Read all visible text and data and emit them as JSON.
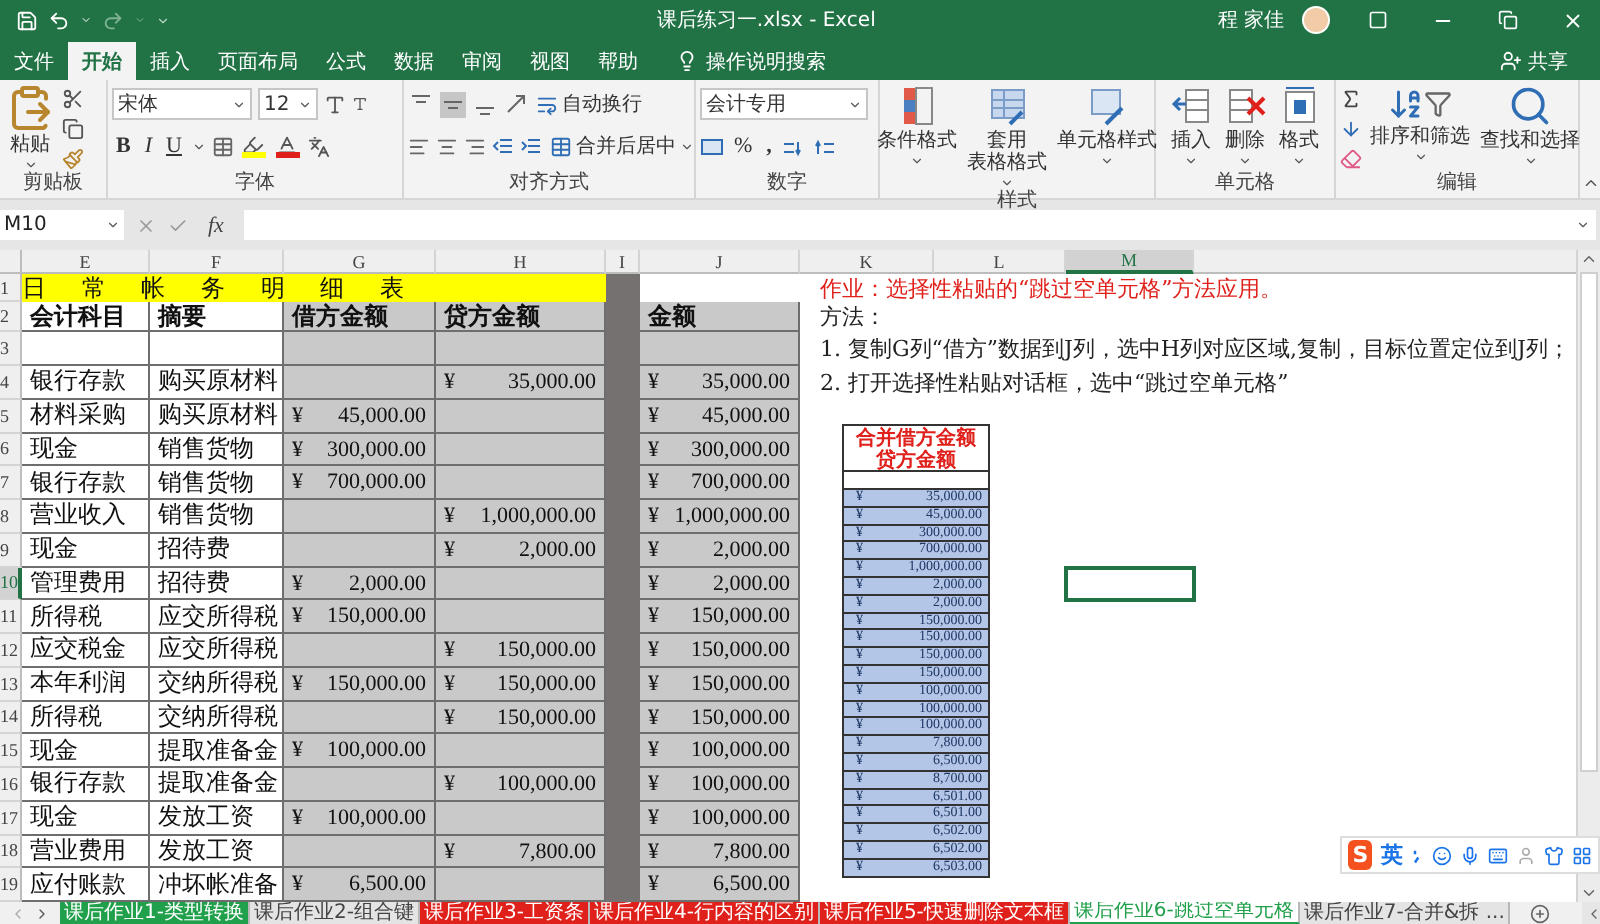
{
  "window": {
    "title": "课后练习一.xlsx - Excel",
    "user": "程 家佳"
  },
  "menu_tabs": [
    {
      "label": "文件",
      "selected": false
    },
    {
      "label": "开始",
      "selected": true
    },
    {
      "label": "插入",
      "selected": false
    },
    {
      "label": "页面布局",
      "selected": false
    },
    {
      "label": "公式",
      "selected": false
    },
    {
      "label": "数据",
      "selected": false
    },
    {
      "label": "审阅",
      "selected": false
    },
    {
      "label": "视图",
      "selected": false
    },
    {
      "label": "帮助",
      "selected": false
    }
  ],
  "tell_me": "操作说明搜索",
  "share": "共享",
  "ribbon": {
    "clipboard": {
      "label": "剪贴板",
      "paste": "粘贴"
    },
    "font": {
      "label": "字体",
      "name": "宋体",
      "size": "12",
      "styles": [
        "B",
        "I",
        "U"
      ]
    },
    "alignment": {
      "label": "对齐方式",
      "wrap": "自动换行",
      "merge": "合并后居中",
      "vertical_align": [
        {
          "selected": false
        },
        {
          "selected": true
        },
        {
          "selected": false
        }
      ]
    },
    "number": {
      "label": "数字",
      "format": "会计专用",
      "percent": "%",
      "comma": ","
    },
    "styles": {
      "label": "样式",
      "items": [
        {
          "lines": [
            "条件格式"
          ]
        },
        {
          "lines": [
            "套用",
            "表格格式"
          ]
        },
        {
          "lines": [
            "单元格样式"
          ]
        }
      ]
    },
    "cells": {
      "label": "单元格",
      "items": [
        "插入",
        "删除",
        "格式"
      ]
    },
    "editing": {
      "label": "编辑",
      "items": [
        "排序和筛选",
        "查找和选择"
      ]
    }
  },
  "formula_bar": {
    "name_box": "M10",
    "fx": "fx"
  },
  "sheet": {
    "columns": [
      {
        "label": "E",
        "selected": false
      },
      {
        "label": "F",
        "selected": false
      },
      {
        "label": "G",
        "selected": false
      },
      {
        "label": "H",
        "selected": false
      },
      {
        "label": "I",
        "selected": false
      },
      {
        "label": "J",
        "selected": false
      },
      {
        "label": "K",
        "selected": false
      },
      {
        "label": "L",
        "selected": false
      },
      {
        "label": "M",
        "selected": true
      }
    ],
    "row_numbers": [
      {
        "label": "1",
        "selected": false
      },
      {
        "label": "2",
        "selected": false
      },
      {
        "label": "3",
        "selected": false
      },
      {
        "label": "4",
        "selected": false
      },
      {
        "label": "5",
        "selected": false
      },
      {
        "label": "6",
        "selected": false
      },
      {
        "label": "7",
        "selected": false
      },
      {
        "label": "8",
        "selected": false
      },
      {
        "label": "9",
        "selected": false
      },
      {
        "label": "10",
        "selected": true
      },
      {
        "label": "11",
        "selected": false
      },
      {
        "label": "12",
        "selected": false
      },
      {
        "label": "13",
        "selected": false
      },
      {
        "label": "14",
        "selected": false
      },
      {
        "label": "15",
        "selected": false
      },
      {
        "label": "16",
        "selected": false
      },
      {
        "label": "17",
        "selected": false
      },
      {
        "label": "18",
        "selected": false
      },
      {
        "label": "19",
        "selected": false
      }
    ],
    "title": "日 常 帐 务 明 细 表",
    "headers": {
      "account": "会计科目",
      "summary": "摘要",
      "debit": "借方金额",
      "credit": "贷方金额",
      "amount": "金额"
    },
    "entries": [
      {
        "account": "银行存款",
        "summary": "购买原材料",
        "credit": "¥ 35,000.00",
        "amount": "¥ 35,000.00"
      },
      {
        "account": "材料采购",
        "summary": "购买原材料",
        "debit": "¥ 45,000.00",
        "amount": "¥ 45,000.00"
      },
      {
        "account": "现金",
        "summary": "销售货物",
        "debit": "¥ 300,000.00",
        "amount": "¥ 300,000.00"
      },
      {
        "account": "银行存款",
        "summary": "销售货物",
        "debit": "¥ 700,000.00",
        "amount": "¥ 700,000.00"
      },
      {
        "account": "营业收入",
        "summary": "销售货物",
        "credit": "¥ 1,000,000.00",
        "amount": "¥ 1,000,000.00"
      },
      {
        "account": "现金",
        "summary": "招待费",
        "credit": "¥ 2,000.00",
        "amount": "¥ 2,000.00"
      },
      {
        "account": "管理费用",
        "summary": "招待费",
        "debit": "¥ 2,000.00",
        "amount": "¥ 2,000.00"
      },
      {
        "account": "所得税",
        "summary": "应交所得税",
        "debit": "¥ 150,000.00",
        "amount": "¥ 150,000.00"
      },
      {
        "account": "应交税金",
        "summary": "应交所得税",
        "credit": "¥ 150,000.00",
        "amount": "¥ 150,000.00"
      },
      {
        "account": "本年利润",
        "summary": "交纳所得税",
        "debit": "¥ 150,000.00",
        "credit": "¥ 150,000.00",
        "amount": "¥ 150,000.00"
      },
      {
        "account": "所得税",
        "summary": "交纳所得税",
        "credit": "¥ 150,000.00",
        "amount": "¥ 150,000.00"
      },
      {
        "account": "现金",
        "summary": "提取准备金",
        "debit": "¥ 100,000.00",
        "amount": "¥ 100,000.00"
      },
      {
        "account": "银行存款",
        "summary": "提取准备金",
        "credit": "¥ 100,000.00",
        "amount": "¥ 100,000.00"
      },
      {
        "account": "现金",
        "summary": "发放工资",
        "debit": "¥ 100,000.00",
        "amount": "¥ 100,000.00"
      },
      {
        "account": "营业费用",
        "summary": "发放工资",
        "credit": "¥ 7,800.00",
        "amount": "¥ 7,800.00"
      },
      {
        "account": "应付账款",
        "summary": "冲坏帐准备",
        "debit": "¥ 6,500.00",
        "amount": "¥ 6,500.00"
      }
    ],
    "notes": [
      {
        "kind": "task",
        "text": "作业：选择性粘贴的“跳过空单元格”方法应用。"
      },
      {
        "kind": "plain",
        "text": "方法："
      },
      {
        "kind": "plain",
        "text": "1. 复制G列“借方”数据到J列，选中H列对应区域,复制，目标位置定位到J列；"
      },
      {
        "kind": "plain",
        "text": "2. 打开选择性粘贴对话框，选中“跳过空单元格”"
      }
    ],
    "picture": {
      "heading_lines": [
        "合并借方金额",
        "贷方金额"
      ],
      "values": [
        "¥ 35,000.00",
        "¥ 45,000.00",
        "¥ 300,000.00",
        "¥ 700,000.00",
        "¥ 1,000,000.00",
        "¥ 2,000.00",
        "¥ 2,000.00",
        "¥ 150,000.00",
        "¥ 150,000.00",
        "¥ 150,000.00",
        "¥ 150,000.00",
        "¥ 100,000.00",
        "¥ 100,000.00",
        "¥ 100,000.00",
        "¥ 7,800.00",
        "¥ 6,500.00",
        "¥ 8,700.00",
        "¥ 6,501.00",
        "¥ 6,501.00",
        "¥ 6,502.00",
        "¥ 6,502.00",
        "¥ 6,503.00"
      ]
    }
  },
  "sheet_tabs": [
    {
      "label": "课后作业1-类型转换",
      "color": "#21a04b",
      "selected": false
    },
    {
      "label": "课后作业2-组合键",
      "selected": false
    },
    {
      "label": "课后作业3-工资条",
      "color": "#e0201b",
      "selected": false
    },
    {
      "label": "课后作业4-行内容的区别",
      "color": "#e0201b",
      "selected": false
    },
    {
      "label": "课后作业5-快速删除文本框",
      "color": "#e0201b",
      "selected": false
    },
    {
      "label": "课后作业6-跳过空单元格",
      "color": "#21a04b",
      "selected": true
    },
    {
      "label": "课后作业7-合并&拆 ...",
      "selected": false
    }
  ],
  "ime": {
    "logo": "S",
    "mode": "英"
  }
}
